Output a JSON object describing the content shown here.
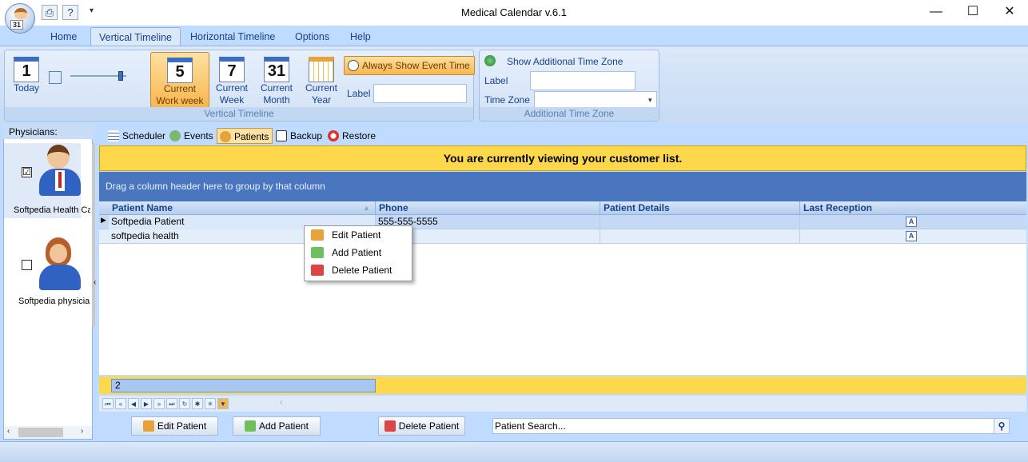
{
  "window": {
    "title": "Medical Calendar v.6.1",
    "app_badge": "31"
  },
  "ribbon_tabs": [
    {
      "label": "Home"
    },
    {
      "label": "Vertical Timeline"
    },
    {
      "label": "Horizontal Timeline"
    },
    {
      "label": "Options"
    },
    {
      "label": "Help"
    }
  ],
  "active_ribbon_tab": "Vertical Timeline",
  "vertical_timeline": {
    "today": {
      "number": "1",
      "label": "Today"
    },
    "work_week": {
      "number": "5",
      "label_line1": "Current",
      "label_line2": "Work week"
    },
    "week": {
      "number": "7",
      "label_line1": "Current",
      "label_line2": "Week"
    },
    "month": {
      "number": "31",
      "label_line1": "Current",
      "label_line2": "Month"
    },
    "year": {
      "label_line1": "Current",
      "label_line2": "Year"
    },
    "always_show_label": "Always Show Event Time",
    "label_caption": "Label",
    "label_value": "",
    "group_caption": "Vertical Timeline"
  },
  "additional_tz": {
    "toggle_label": "Show Additional Time Zone",
    "label_caption": "Label",
    "label_value": "",
    "timezone_caption": "Time Zone",
    "timezone_value": "",
    "group_caption": "Additional Time Zone"
  },
  "physicians": {
    "caption": "Physicians:",
    "items": [
      {
        "name": "Softpedia Health Ca",
        "checked": true,
        "check_glyph": "☑"
      },
      {
        "name": "Softpedia physicia",
        "checked": false,
        "check_glyph": ""
      }
    ]
  },
  "content_tabs": [
    {
      "label": "Scheduler"
    },
    {
      "label": "Events"
    },
    {
      "label": "Patients"
    },
    {
      "label": "Backup"
    },
    {
      "label": "Restore"
    }
  ],
  "active_content_tab": "Patients",
  "banner": "You are currently viewing your customer list.",
  "group_area_hint": "Drag a column header here to group by that column",
  "grid": {
    "columns": [
      "Patient Name",
      "Phone",
      "Patient Details",
      "Last Reception"
    ],
    "rows": [
      {
        "name": "Softpedia Patient",
        "phone": "555-555-5555",
        "details": "",
        "last_reception": ""
      },
      {
        "name": "softpedia health",
        "phone": "",
        "details": "",
        "last_reception": ""
      }
    ],
    "count": "2"
  },
  "context_menu": {
    "items": [
      {
        "label": "Edit Patient"
      },
      {
        "label": "Add Patient"
      },
      {
        "label": "Delete Patient"
      }
    ]
  },
  "bottom_buttons": {
    "edit": "Edit Patient",
    "add": "Add Patient",
    "delete": "Delete Patient"
  },
  "search": {
    "value": "Patient Search..."
  },
  "colors": {
    "accent": "#4a76c0",
    "banner": "#fdd84d",
    "ribbon": "#bfdbff"
  }
}
